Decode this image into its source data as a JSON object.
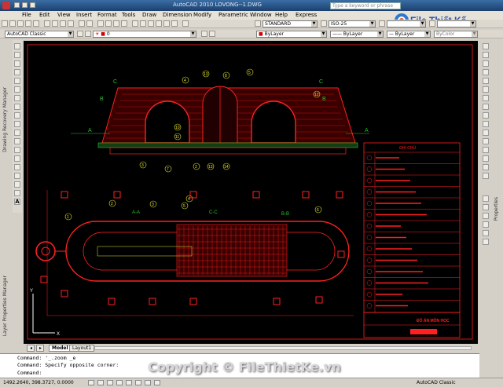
{
  "window": {
    "title": "AutoCAD 2010    LOVONG--1.DWG"
  },
  "search": {
    "placeholder": "Type a keyword or phrase"
  },
  "menu": [
    "File",
    "Edit",
    "View",
    "Insert",
    "Format",
    "Tools",
    "Draw",
    "Dimension",
    "Modify",
    "Parametric",
    "Window",
    "Help",
    "Express"
  ],
  "toolbar": {
    "workspace": "AutoCAD Classic",
    "layer": "0",
    "text_style": "STANDARD",
    "dim_style": "ISO-25",
    "color": "ByLayer",
    "linetype": "ByLayer",
    "lineweight": "ByLayer",
    "plotstyle": "ByColor"
  },
  "palettes": {
    "left_top": "Drawing Recovery Manager",
    "left_bottom": "Layer Properties Manager",
    "right": "Properties"
  },
  "tabs": {
    "model": "Model",
    "layout": "Layout1"
  },
  "command": {
    "line1": "Command: '_.zoom _e",
    "line2": "Command: Specify opposite corner:",
    "line3": "Command:"
  },
  "status": {
    "coords": "1492.2640, 398.3727, 0.0000",
    "workspace": "AutoCAD Classic"
  },
  "watermark": {
    "logo_text": "File Thiết Kế",
    "logo_suffix": ".vn",
    "copyright": "Copyright © FileThietKe.vn"
  },
  "drawing": {
    "section_labels": {
      "c_left": "C",
      "c_right": "C",
      "b_left": "B",
      "b_right": "B",
      "a_left": "A",
      "a_right": "A",
      "aa": "A-A",
      "cc": "C-C",
      "bb": "B-B"
    },
    "callouts_top": [
      "4",
      "13",
      "8",
      "5",
      "12",
      "10",
      "11",
      "2",
      "13",
      "14",
      "7",
      "3"
    ],
    "callouts_plan": [
      "1",
      "2",
      "3",
      "4",
      "5",
      "6"
    ],
    "legend_title": "GHI CHÚ",
    "legend_rows": 14,
    "title_block": "ĐỒ ÁN MÔN HỌC"
  },
  "colors": {
    "canvas": "#000000",
    "red": "#ff2020",
    "green": "#2fbf2f",
    "yellow": "#e8e830"
  }
}
